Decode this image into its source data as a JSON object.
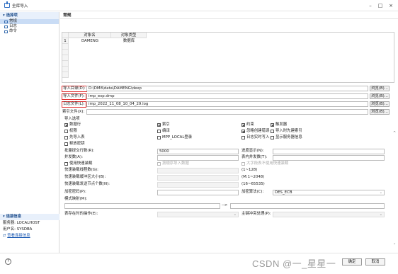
{
  "window": {
    "title": "全库导入",
    "min": "–",
    "max": "□",
    "close": "×"
  },
  "sidebar": {
    "header": "▾ 选择项",
    "items": [
      {
        "label": "常规",
        "selected": true
      },
      {
        "label": "日志",
        "selected": false
      },
      {
        "label": "命令",
        "selected": false
      }
    ],
    "connection": {
      "header": "▾ 连接信息",
      "server": "服务器: LOCALHOST",
      "user": "用户名: SYSDBA",
      "link": "查看连接信息"
    }
  },
  "main": {
    "header": "常规",
    "grid": {
      "columns": [
        "对象名",
        "对象类型"
      ],
      "rows": [
        {
          "num": "1",
          "name": "DAMENG",
          "type": "数据库"
        }
      ]
    },
    "files": [
      {
        "label": "导入目录(D):",
        "value": "D:\\DM8\\data\\DAMENG\\dexp",
        "highlight": true,
        "browse": "浏览(B)..."
      },
      {
        "label": "导入文件(F):",
        "value": "imp_exp.dmp",
        "highlight": true,
        "browse": "浏览(B)..."
      },
      {
        "label": "日志文件(L):",
        "value": "imp_2022_11_08_10_04_29.log",
        "highlight": true,
        "browse": "浏览(B)..."
      },
      {
        "label": "索引文件(X):",
        "value": "",
        "highlight": false,
        "browse": "浏览(B)..."
      }
    ],
    "options_title": "导入选项",
    "options": [
      {
        "label": "数据行",
        "checked": true,
        "disabled": false
      },
      {
        "label": "索引",
        "checked": true,
        "disabled": false
      },
      {
        "label": "约束",
        "checked": true,
        "disabled": false
      },
      {
        "label": "触发器",
        "checked": true,
        "disabled": false
      },
      {
        "label": "权限",
        "checked": false,
        "disabled": false
      },
      {
        "label": "编译",
        "checked": false,
        "disabled": false
      },
      {
        "label": "忽略创建错误",
        "checked": true,
        "disabled": false
      },
      {
        "label": "导入时先建索引",
        "checked": false,
        "disabled": false
      },
      {
        "label": "先导入表",
        "checked": false,
        "disabled": false
      },
      {
        "label": "MPP_LOCAL登录",
        "checked": false,
        "disabled": false
      },
      {
        "label": "日志实时写入",
        "checked": false,
        "disabled": false
      },
      {
        "label": "显示服务器信息",
        "checked": false,
        "disabled": false
      },
      {
        "label": "释放密钥",
        "checked": false,
        "disabled": false
      }
    ],
    "params": {
      "batch_label": "批量提交行数(R):",
      "batch_value": "5000",
      "progress_label": "进度显示(N):",
      "progress_value": "",
      "parallel_label": "并发数(A):",
      "parallel_value": "",
      "table_parallel_label": "表内并发数(T):",
      "table_parallel_value": "",
      "fastload_label": "使用快速装载",
      "by_order_label": "按顺序导入数据",
      "bigtable_label": "大字段表不使用快速装载",
      "fast_threads_label": "快速装载线程数(G):",
      "fast_threads_hint": "(1~128)",
      "fast_buffer_label": "快速装载缓冲区大小(B):",
      "fast_buffer_hint": "(M:1~2048)",
      "fast_nodes_label": "快速装载发送节点个数(N):",
      "fast_nodes_hint": "(16~65535)",
      "encrypt_pwd_label": "加密密码(P):",
      "encrypt_pwd_value": "",
      "encrypt_alg_label": "加密算法(C):",
      "encrypt_alg_value": "DES_ECB",
      "remap_label": "模式映射(M):",
      "remap_arrow": "-->",
      "table_exists_label": "表存在时的操作(E):",
      "table_exists_value": "",
      "primary_conflict_label": "主键冲突处理(P):",
      "primary_conflict_value": ""
    }
  },
  "footer": {
    "help": "?",
    "watermark": "CSDN @一_星星一",
    "ok": "确定",
    "cancel": "取消"
  }
}
